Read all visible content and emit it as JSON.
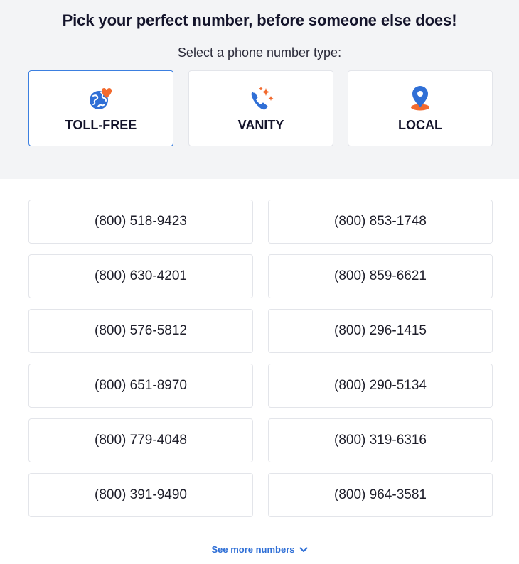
{
  "header": {
    "headline": "Pick your perfect number, before someone else does!",
    "subhead": "Select a phone number type:"
  },
  "types": [
    {
      "label": "TOLL-FREE",
      "icon": "globe-heart-icon",
      "selected": true
    },
    {
      "label": "VANITY",
      "icon": "phone-sparkle-icon",
      "selected": false
    },
    {
      "label": "LOCAL",
      "icon": "location-pin-icon",
      "selected": false
    }
  ],
  "numbers": [
    "(800) 518-9423",
    "(800) 853-1748",
    "(800) 630-4201",
    "(800) 859-6621",
    "(800) 576-5812",
    "(800) 296-1415",
    "(800) 651-8970",
    "(800) 290-5134",
    "(800) 779-4048",
    "(800) 319-6316",
    "(800) 391-9490",
    "(800) 964-3581"
  ],
  "footer": {
    "see_more": "See more numbers",
    "chevron_icon": "chevron-down-icon"
  },
  "colors": {
    "accent_blue": "#2f6fd6",
    "accent_orange": "#f26a2e",
    "selected_border": "#3b7fe0"
  }
}
